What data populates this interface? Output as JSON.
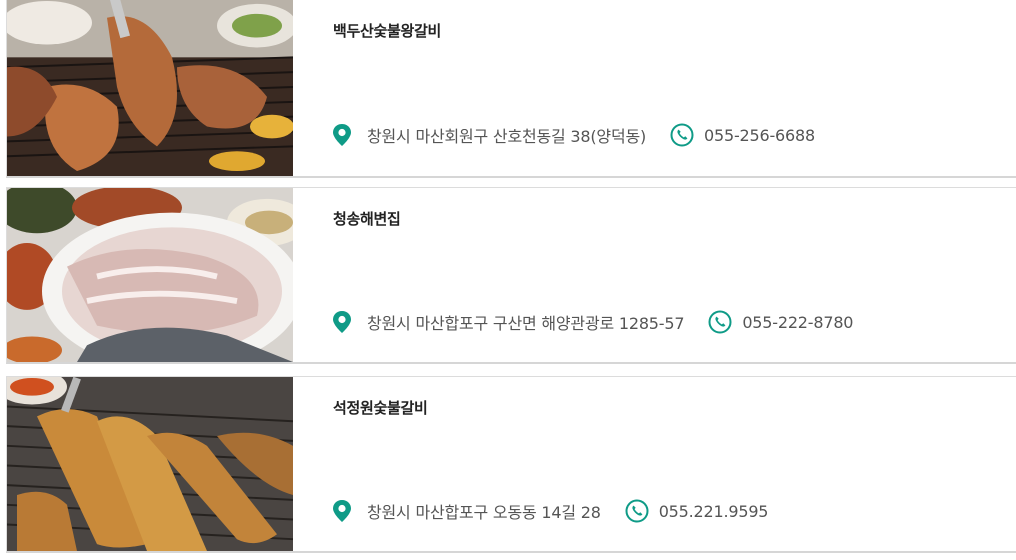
{
  "restaurants": [
    {
      "name": "백두산숯불왕갈비",
      "address": "창원시 마산회원구 산호천동길 38(양덕동)",
      "phone": "055-256-6688",
      "image": "grilled-galbi-photo"
    },
    {
      "name": "청송해변집",
      "address": "창원시 마산합포구 구산면 해양관광로 1285-57",
      "phone": "055-222-8780",
      "image": "sliced-raw-fish-photo"
    },
    {
      "name": "석정원숯불갈비",
      "address": "창원시 마산합포구 오동동 14길 28",
      "phone": "055.221.9595",
      "image": "charcoal-grilled-meat-photo"
    }
  ],
  "icons": {
    "location": "map-pin-icon",
    "phone": "phone-icon"
  },
  "colors": {
    "accent": "#0f9b87",
    "title": "#222222",
    "text": "#555555",
    "divider": "#d6d6d6"
  }
}
